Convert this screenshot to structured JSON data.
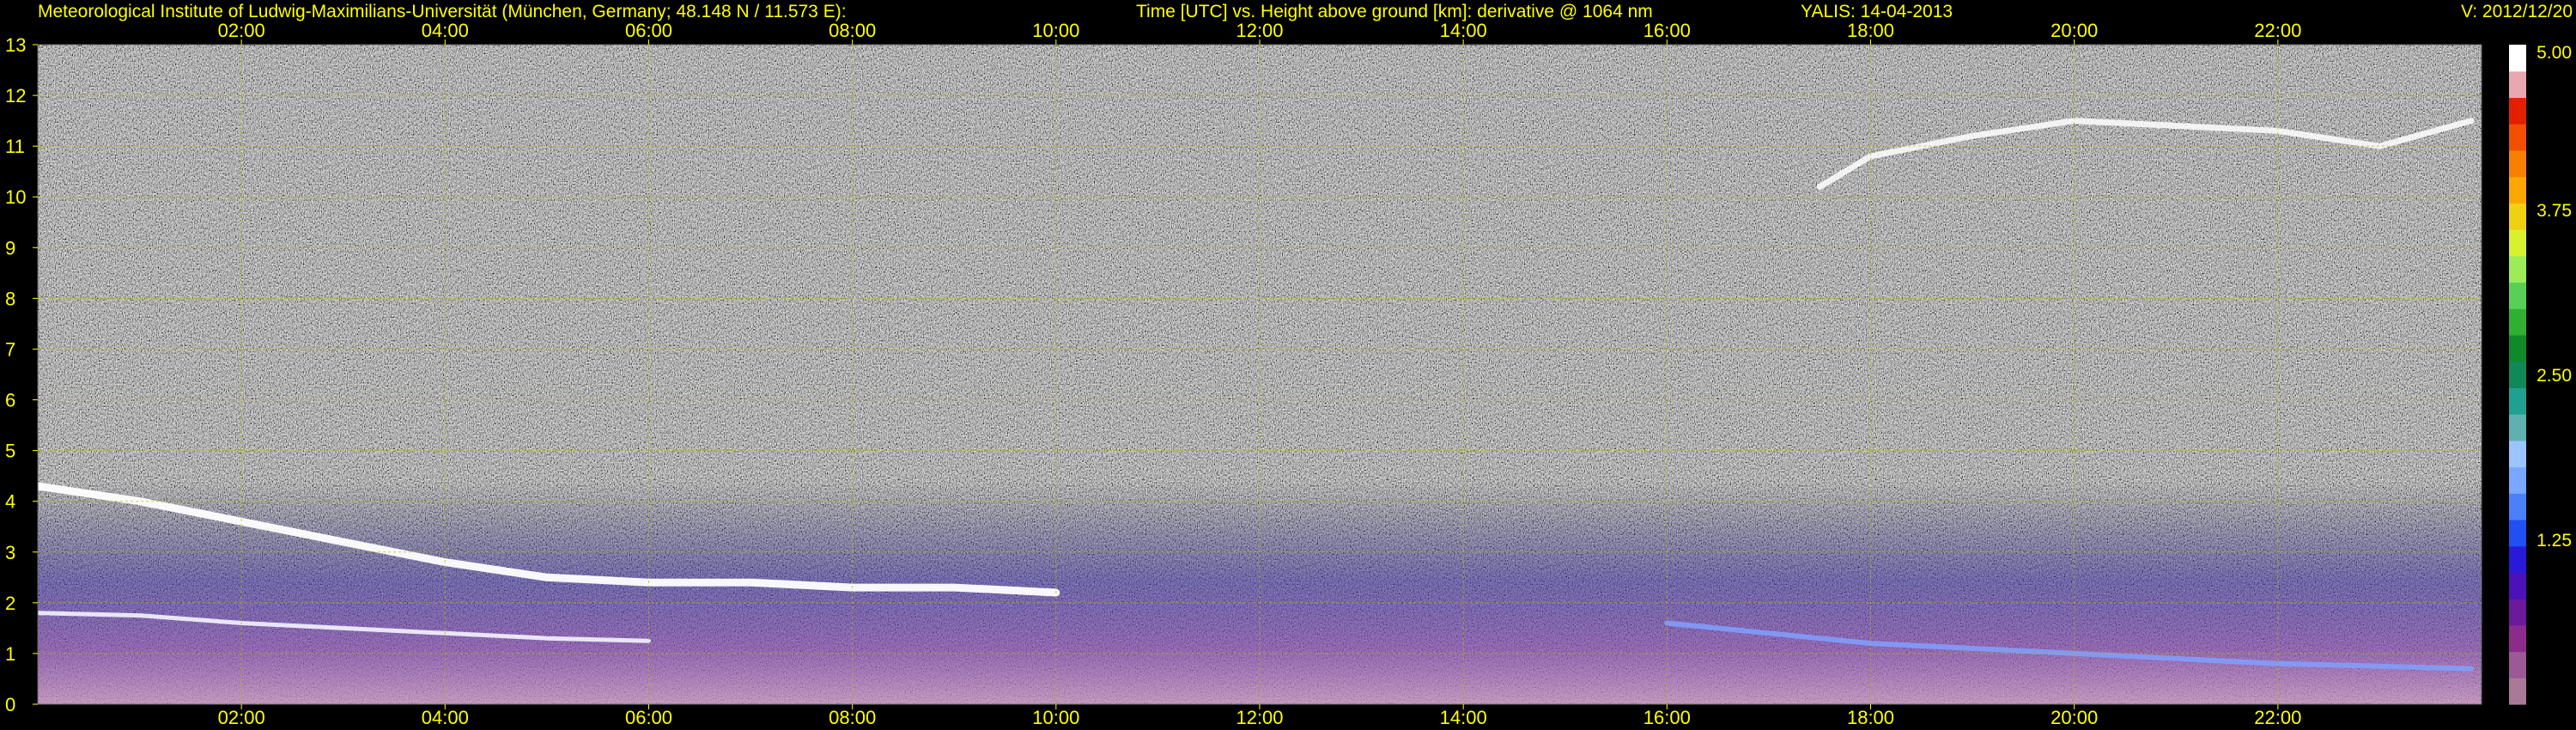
{
  "header": {
    "institute": "Meteorological Institute of Ludwig-Maximilians-Universität (München, Germany; 48.148 N / 11.573 E):",
    "plot_title": "Time [UTC] vs. Height above ground [km]: derivative @ 1064 nm",
    "instrument_date": "YALIS: 14-04-2013",
    "version": "V: 2012/12/20"
  },
  "colors": {
    "background": "#000000",
    "text": "#ffff00",
    "plot_noise": "#8a8a8a",
    "grid": "#b8b800"
  },
  "chart_data": {
    "type": "heatmap",
    "x_unit": "UTC hour",
    "y_unit": "km",
    "xlim": [
      0,
      24
    ],
    "ylim": [
      0,
      13
    ],
    "x_ticks": [
      2,
      4,
      6,
      8,
      10,
      12,
      14,
      16,
      18,
      20,
      22
    ],
    "x_tick_labels": [
      "02:00",
      "04:00",
      "06:00",
      "08:00",
      "10:00",
      "12:00",
      "14:00",
      "16:00",
      "18:00",
      "20:00",
      "22:00"
    ],
    "y_ticks": [
      0,
      1,
      2,
      3,
      4,
      5,
      6,
      7,
      8,
      9,
      10,
      11,
      12,
      13
    ],
    "y_tick_labels": [
      "0",
      "1",
      "2",
      "3",
      "4",
      "5",
      "6",
      "7",
      "8",
      "9",
      "10",
      "11",
      "12",
      "13"
    ],
    "grid": true,
    "colorbar": {
      "range": [
        0,
        5
      ],
      "tick_values": [
        1.25,
        2.5,
        3.75,
        5.0
      ],
      "tick_labels": [
        "1.25",
        "2.50",
        "3.75",
        "5.00"
      ],
      "colors": [
        "#a87a98",
        "#9b5a96",
        "#8b2c8c",
        "#6b1a9a",
        "#4a12b8",
        "#2a1ad8",
        "#2050f0",
        "#4a80f8",
        "#78a8ff",
        "#9cc4ff",
        "#60b0b0",
        "#20a090",
        "#108858",
        "#108a28",
        "#30b030",
        "#58d058",
        "#9cec5a",
        "#d8f030",
        "#f0d010",
        "#f8a800",
        "#f88000",
        "#f05000",
        "#e02000",
        "#e8a8b0",
        "#ffffff"
      ]
    },
    "features": [
      {
        "kind": "residual_layer_top",
        "points": [
          [
            0.0,
            4.3
          ],
          [
            1.0,
            4.0
          ],
          [
            2.0,
            3.6
          ],
          [
            3.0,
            3.2
          ],
          [
            4.0,
            2.8
          ],
          [
            5.0,
            2.5
          ],
          [
            6.0,
            2.4
          ],
          [
            7.0,
            2.4
          ],
          [
            8.0,
            2.3
          ],
          [
            9.0,
            2.3
          ],
          [
            10.0,
            2.2
          ]
        ]
      },
      {
        "kind": "boundary_layer",
        "points": [
          [
            0.0,
            1.8
          ],
          [
            1.0,
            1.75
          ],
          [
            2.0,
            1.6
          ],
          [
            3.0,
            1.5
          ],
          [
            4.0,
            1.4
          ],
          [
            5.0,
            1.3
          ],
          [
            6.0,
            1.25
          ]
        ]
      },
      {
        "kind": "cirrus",
        "points": [
          [
            17.5,
            10.2
          ],
          [
            18.0,
            10.8
          ],
          [
            19.0,
            11.2
          ],
          [
            20.0,
            11.5
          ],
          [
            21.0,
            11.4
          ],
          [
            22.0,
            11.3
          ],
          [
            23.0,
            11.0
          ],
          [
            23.9,
            11.5
          ]
        ]
      },
      {
        "kind": "low_layer_evening",
        "points": [
          [
            16.0,
            1.6
          ],
          [
            17.0,
            1.4
          ],
          [
            18.0,
            1.2
          ],
          [
            19.0,
            1.1
          ],
          [
            20.0,
            1.0
          ],
          [
            21.0,
            0.9
          ],
          [
            22.0,
            0.8
          ],
          [
            23.0,
            0.75
          ],
          [
            23.9,
            0.7
          ]
        ]
      }
    ]
  }
}
